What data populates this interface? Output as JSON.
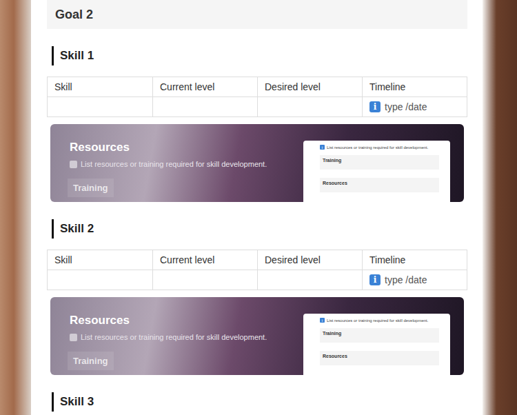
{
  "goal": {
    "title": "Goal 2"
  },
  "skills": [
    {
      "title": "Skill 1",
      "table": {
        "columns": [
          "Skill",
          "Current level",
          "Desired level",
          "Timeline"
        ],
        "rows": [
          {
            "cells": [
              "",
              "",
              ""
            ],
            "timeline": {
              "icon": "i",
              "placeholder": "type /date"
            }
          }
        ]
      },
      "resources": {
        "title": "Resources",
        "checkbox_label": "List resources or training required for skill development.",
        "checked": false,
        "button": "Training",
        "preview": {
          "icon": "i",
          "note": "List resources or training required for skill development.",
          "sections": [
            "Training",
            "Resources"
          ]
        }
      }
    },
    {
      "title": "Skill 2",
      "table": {
        "columns": [
          "Skill",
          "Current level",
          "Desired level",
          "Timeline"
        ],
        "rows": [
          {
            "cells": [
              "",
              "",
              ""
            ],
            "timeline": {
              "icon": "i",
              "placeholder": "type /date"
            }
          }
        ]
      },
      "resources": {
        "title": "Resources",
        "checkbox_label": "List resources or training required for skill development.",
        "checked": false,
        "button": "Training",
        "preview": {
          "icon": "i",
          "note": "List resources or training required for skill development.",
          "sections": [
            "Training",
            "Resources"
          ]
        }
      }
    },
    {
      "title": "Skill 3"
    }
  ]
}
